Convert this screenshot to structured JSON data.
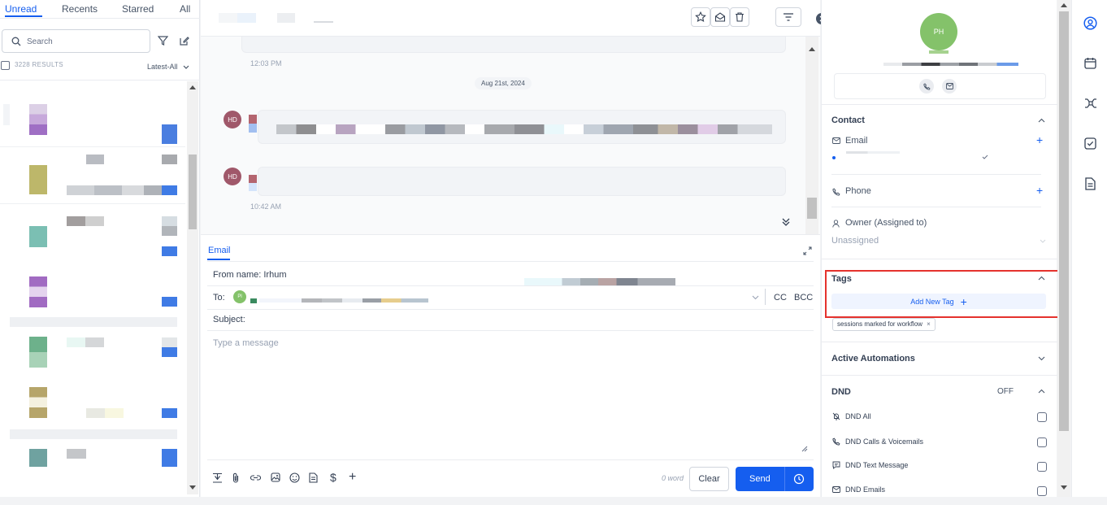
{
  "tabs": [
    "Unread",
    "Recents",
    "Starred",
    "All"
  ],
  "search": {
    "placeholder": "Search"
  },
  "results": {
    "label": "3228 RESULTS",
    "sort": "Latest-All"
  },
  "conversation": {
    "time1": "12:03 PM",
    "date_chip": "Aug 21st, 2024",
    "time2": "10:42 AM",
    "avatar_initials": "HD"
  },
  "composer": {
    "channel_tab": "Email",
    "from_label": "From name:",
    "from_value": "Irhum",
    "to_label": "To:",
    "to_avatar": "Pl",
    "cc": "CC",
    "bcc": "BCC",
    "subject_label": "Subject:",
    "message_placeholder": "Type a message",
    "word_count": "0 word",
    "clear": "Clear",
    "send": "Send"
  },
  "contact_panel": {
    "avatar_initials": "PH",
    "contact_title": "Contact",
    "email_label": "Email",
    "phone_label": "Phone",
    "owner_label": "Owner (Assigned to)",
    "owner_value": "Unassigned",
    "tags_title": "Tags",
    "add_tag": "Add New Tag",
    "tag_chip": "sessions marked for workflow",
    "automations_title": "Active Automations",
    "dnd_title": "DND",
    "dnd_state": "OFF",
    "dnd_items": [
      "DND All",
      "DND Calls & Voicemails",
      "DND Text Message",
      "DND Emails"
    ]
  },
  "colors": {
    "accent": "#155eef",
    "highlight": "#e5322d",
    "avatar_green": "#84c26a",
    "avatar_msg": "#a0586a"
  }
}
